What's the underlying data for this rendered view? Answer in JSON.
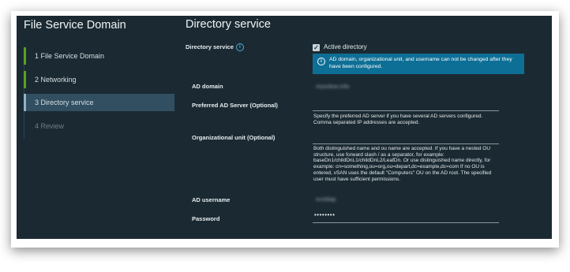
{
  "wizard": {
    "title": "File Service Domain",
    "steps": [
      {
        "label": "1  File Service Domain",
        "state": "completed"
      },
      {
        "label": "2  Networking",
        "state": "completed"
      },
      {
        "label": "3  Directory service",
        "state": "active"
      },
      {
        "label": "4  Review",
        "state": "disabled"
      }
    ]
  },
  "page": {
    "title": "Directory service",
    "directory_service_label": "Directory service",
    "active_directory_checkbox": {
      "label": "Active directory",
      "checked": true
    },
    "alert": "AD domain, organizational unit, and username can not be changed after they have been configured.",
    "ad_domain": {
      "label": "AD domain",
      "value": "rtsonline.info"
    },
    "preferred_ad_server": {
      "label": "Preferred AD Server (Optional)",
      "value": "",
      "help": "Specify the preferred AD server if you have several AD servers configured. Comma separated IP addresses are accepted."
    },
    "organizational_unit": {
      "label": "Organizational unit (Optional)",
      "value": "",
      "help": "Both distinguished name and ou name are accepted. If you have a nested OU structure, use forward slash / as a separator, for example: baseDn1/childDnL1/childDnL2/LeafDn. Or use distinguished name directly, for example: cn=something,ou=org,ou=depart,dc=example,dc=com If no OU is entered, vSAN uses the default \"Computers\" OU on the AD root. The specified user must have sufficient permissions."
    },
    "ad_username": {
      "label": "AD username",
      "value": "svcldap"
    },
    "password": {
      "label": "Password",
      "value": "••••••••"
    }
  },
  "colors": {
    "background": "#1b2a32",
    "completed_bar": "#5aa220",
    "active_step_bg": "#324f61",
    "alert_bg": "#0e6f96",
    "info_blue": "#49afd9"
  }
}
